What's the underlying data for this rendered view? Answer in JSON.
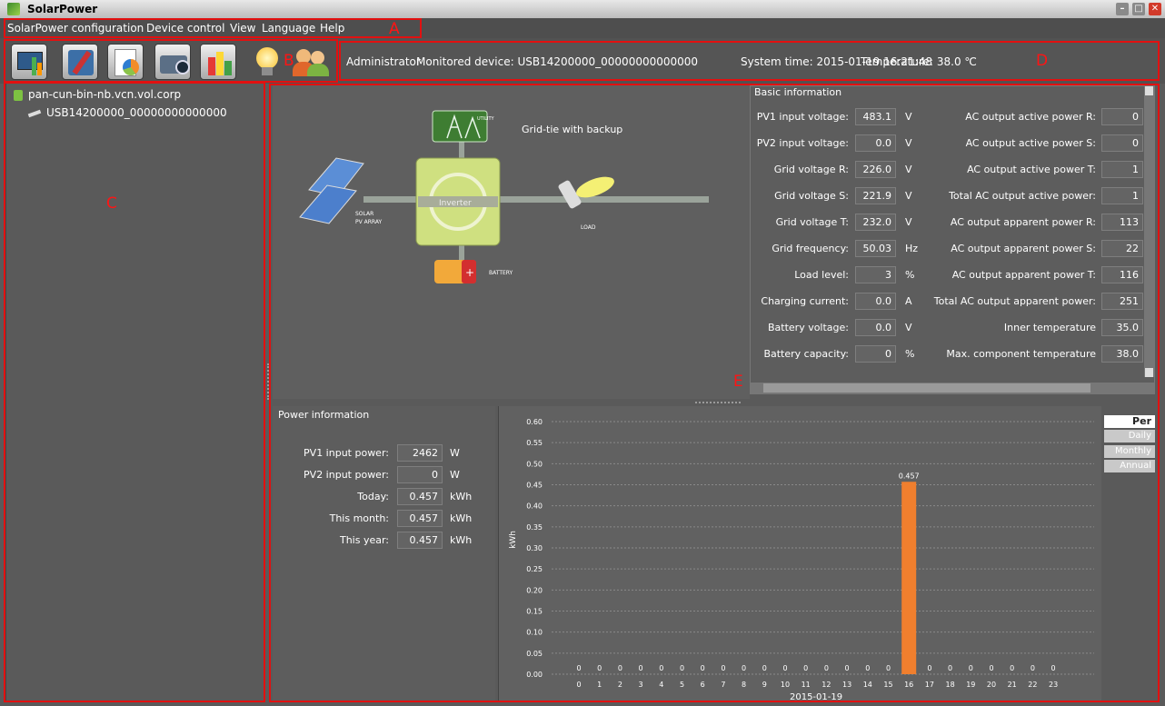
{
  "window": {
    "title": "SolarPower"
  },
  "menu": [
    "SolarPower configuration",
    "Device control",
    "View",
    "Language",
    "Help"
  ],
  "toolbar_icons": [
    "dashboard-icon",
    "tools-config-icon",
    "report-pie-icon",
    "camera-device-icon",
    "data-chart-icon",
    "alarm-bulb-icon",
    "users-icon"
  ],
  "status": {
    "user": "Administrator",
    "device": "Monitored device: USB14200000_00000000000000",
    "time": "System time: 2015-01-19 16:21:48",
    "temperature": "Temperature: 38.0 ℃"
  },
  "tree": {
    "host": "pan-cun-bin-nb.vcn.vol.corp",
    "device": "USB14200000_00000000000000"
  },
  "annotations": {
    "a": "A",
    "b": "B",
    "c": "C",
    "d": "D",
    "e": "E"
  },
  "diagram": {
    "mode": "Grid-tie with backup",
    "utility": "UTILITY",
    "inverter": "Inverter",
    "solar": "SOLAR PV ARRAY",
    "load": "LOAD",
    "battery": "BATTERY"
  },
  "basic": {
    "title": "Basic information",
    "left": [
      {
        "label": "PV1 input voltage:",
        "value": "483.1",
        "unit": "V"
      },
      {
        "label": "PV2 input voltage:",
        "value": "0.0",
        "unit": "V"
      },
      {
        "label": "Grid voltage R:",
        "value": "226.0",
        "unit": "V"
      },
      {
        "label": "Grid voltage S:",
        "value": "221.9",
        "unit": "V"
      },
      {
        "label": "Grid voltage T:",
        "value": "232.0",
        "unit": "V"
      },
      {
        "label": "Grid frequency:",
        "value": "50.03",
        "unit": "Hz"
      },
      {
        "label": "Load level:",
        "value": "3",
        "unit": "%"
      },
      {
        "label": "Charging current:",
        "value": "0.0",
        "unit": "A"
      },
      {
        "label": "Battery voltage:",
        "value": "0.0",
        "unit": "V"
      },
      {
        "label": "Battery capacity:",
        "value": "0",
        "unit": "%"
      }
    ],
    "right": [
      {
        "label": "AC output active power R:",
        "value": "0"
      },
      {
        "label": "AC output active power S:",
        "value": "0"
      },
      {
        "label": "AC output active power T:",
        "value": "1"
      },
      {
        "label": "Total AC output active power:",
        "value": "1"
      },
      {
        "label": "AC output apparent power R:",
        "value": "113"
      },
      {
        "label": "AC output apparent power S:",
        "value": "22"
      },
      {
        "label": "AC output apparent power T:",
        "value": "116"
      },
      {
        "label": "Total AC output apparent power:",
        "value": "251"
      },
      {
        "label": "Inner temperature",
        "value": "35.0"
      },
      {
        "label": "Max. component temperature",
        "value": "38.0"
      }
    ]
  },
  "power": {
    "title": "Power information",
    "rows": [
      {
        "label": "PV1 input power:",
        "value": "2462",
        "unit": "W"
      },
      {
        "label": "PV2 input power:",
        "value": "0",
        "unit": "W"
      },
      {
        "label": "Today:",
        "value": "0.457",
        "unit": "kWh"
      },
      {
        "label": "This month:",
        "value": "0.457",
        "unit": "kWh"
      },
      {
        "label": "This year:",
        "value": "0.457",
        "unit": "kWh"
      }
    ]
  },
  "period_tabs": [
    "Per hour",
    "Daily",
    "Monthly",
    "Annual"
  ],
  "colors": {
    "bar": "#f07f2e",
    "annotation": "#e21010"
  },
  "chart_data": {
    "type": "bar",
    "categories": [
      "0",
      "1",
      "2",
      "3",
      "4",
      "5",
      "6",
      "7",
      "8",
      "9",
      "10",
      "11",
      "12",
      "13",
      "14",
      "15",
      "16",
      "17",
      "18",
      "19",
      "20",
      "21",
      "22",
      "23"
    ],
    "values": [
      0,
      0,
      0,
      0,
      0,
      0,
      0,
      0,
      0,
      0,
      0,
      0,
      0,
      0,
      0,
      0,
      0.457,
      0,
      0,
      0,
      0,
      0,
      0,
      0
    ],
    "data_labels": [
      "0",
      "0",
      "0",
      "0",
      "0",
      "0",
      "0",
      "0",
      "0",
      "0",
      "0",
      "0",
      "0",
      "0",
      "0",
      "0",
      "0.457",
      "0",
      "0",
      "0",
      "0",
      "0",
      "0",
      "0"
    ],
    "yticks": [
      "0.00",
      "0.05",
      "0.10",
      "0.15",
      "0.20",
      "0.25",
      "0.30",
      "0.35",
      "0.40",
      "0.45",
      "0.50",
      "0.55",
      "0.60"
    ],
    "ylim": [
      0,
      0.6
    ],
    "ylabel": "kWh",
    "xlabel": "2015-01-19",
    "grid": true
  }
}
